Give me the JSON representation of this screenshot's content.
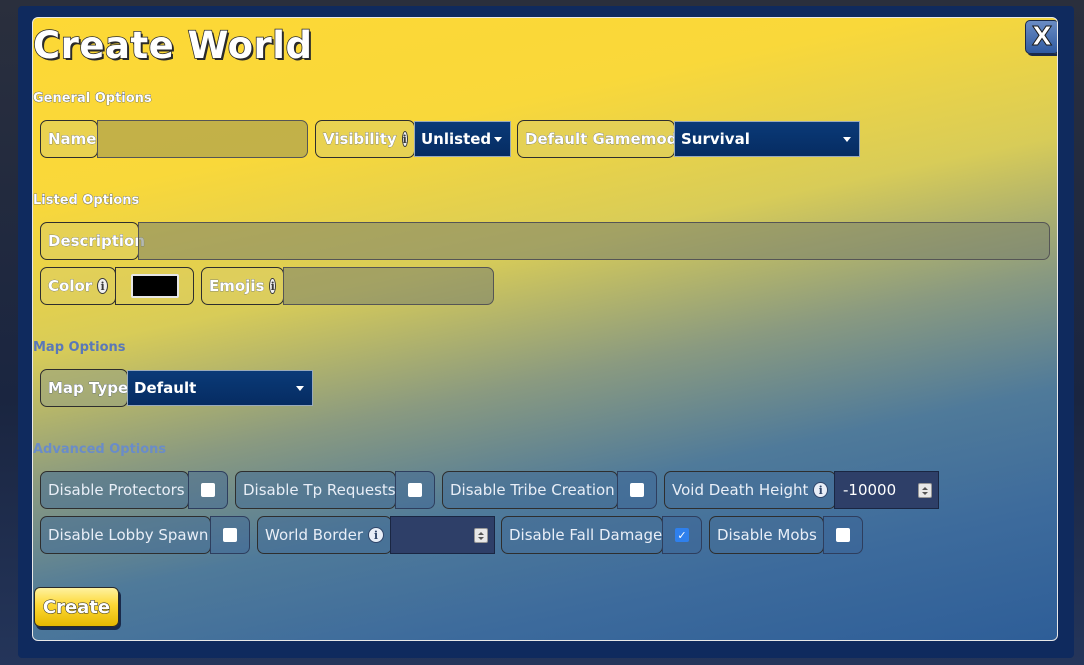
{
  "dialog": {
    "title": "Create World",
    "close_label": "X"
  },
  "general": {
    "header": "General Options",
    "name_label": "Name",
    "name_value": "",
    "visibility_label": "Visibility",
    "visibility_value": "Unlisted",
    "gamemode_label": "Default Gamemode",
    "gamemode_value": "Survival"
  },
  "listed": {
    "header": "Listed Options",
    "description_label": "Description",
    "description_value": "",
    "color_label": "Color",
    "color_value": "#000000",
    "emojis_label": "Emojis",
    "emojis_value": ""
  },
  "map": {
    "header": "Map Options",
    "type_label": "Map Type",
    "type_value": "Default"
  },
  "advanced": {
    "header": "Advanced Options",
    "disable_protectors_label": "Disable Protectors",
    "disable_protectors_checked": false,
    "disable_tp_label": "Disable Tp Requests",
    "disable_tp_checked": false,
    "disable_tribe_label": "Disable Tribe Creation",
    "disable_tribe_checked": false,
    "void_height_label": "Void Death Height",
    "void_height_value": "-10000",
    "disable_lobby_label": "Disable Lobby Spawn",
    "disable_lobby_checked": false,
    "world_border_label": "World Border",
    "world_border_value": "",
    "disable_fall_label": "Disable Fall Damage",
    "disable_fall_checked": true,
    "disable_mobs_label": "Disable Mobs",
    "disable_mobs_checked": false
  },
  "actions": {
    "create_label": "Create"
  },
  "icons": {
    "info": "info-icon",
    "caret": "caret-down-icon",
    "check": "checkmark-icon"
  },
  "colors": {
    "title_fill": "#ffffff",
    "select_bg": "#0a3a78",
    "gradient_top": "#fdd835",
    "gradient_bottom": "#2e5e98",
    "checkbox_checked": "#2f80ed"
  }
}
